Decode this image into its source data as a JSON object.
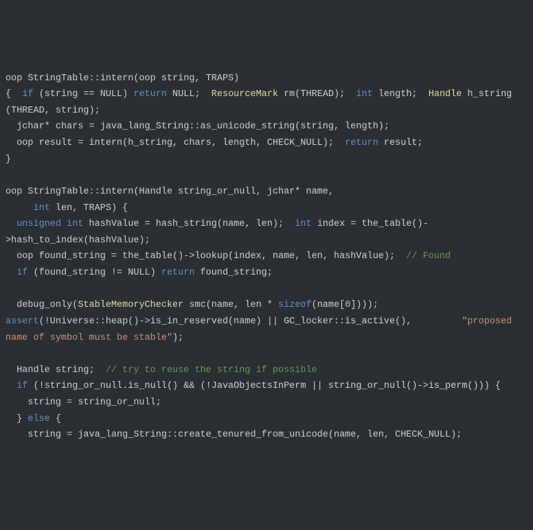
{
  "code": {
    "t1": "oop StringTable::intern(oop string, TRAPS)",
    "t2a": "{  ",
    "kw_if1": "if",
    "t2b": " (string == NULL) ",
    "kw_return1": "return",
    "t2c": " NULL;  ",
    "class_ResourceMark": "ResourceMark",
    "t2d": " rm(THREAD);  ",
    "kw_int1": "int",
    "t2e": " length;  ",
    "class_Handle1": "H",
    "class_Handle1b": "andle",
    "t2f": " h_string (THREAD, string);",
    "t3a": "  jchar* chars = java_lang_String::as_unicode_string(string, length);",
    "t4a": "  oop result = intern(h_string, chars, length, CHECK_NULL);  ",
    "kw_return2": "return",
    "t4b": " result;",
    "t5": "}",
    "t6": "",
    "t7": "oop StringTable::intern(Handle string_or_null, jchar* name,",
    "t8a": "     ",
    "kw_int2": "int",
    "t8b": " len, TRAPS) {",
    "t9a": "  ",
    "kw_unsigned": "unsigned",
    "t9b": " ",
    "kw_int3": "int",
    "t9c": " hashValue = hash_string(name, len);  ",
    "kw_int4": "int",
    "t9d": " index = the_table()->hash_to_index(hashValue);",
    "t10a": "  oop found_string = the_table()->lookup(index, name, len, hashValue);  ",
    "comment1": "// Found",
    "t11a": "  ",
    "kw_if2": "if",
    "t11b": " (found_string != NULL) ",
    "kw_return3": "return",
    "t11c": " found_string;",
    "t12": "",
    "t13a": "  debug_only(",
    "class_StableMemoryChecker": "StableMemoryChecker",
    "t13b": " smc(name, len * ",
    "kw_sizeof": "sizeof",
    "t13c": "(name[",
    "num0": "0",
    "t13d": "])));  ",
    "kw_assert": "assert",
    "t13e": "(!Universe::heap()->is_in_reserved(name) || GC_locker::is_active(),         ",
    "str1": "\"proposed name of symbol must be stable\"",
    "t13f": ");",
    "t14": "",
    "t15a": "  Handle string;  ",
    "comment2": "// try to reuse the string if possible",
    "t16a": "  ",
    "kw_if3": "if",
    "t16b": " (!string_or_null.is_null() && (!JavaObjectsInPerm || string_or_null()->is_perm())) {",
    "t17": "    string = string_or_null;",
    "t18a": "  } ",
    "kw_else": "else",
    "t18b": " {",
    "t19": "    string = java_lang_String::create_tenured_from_unicode(name, len, CHECK_NULL);"
  }
}
